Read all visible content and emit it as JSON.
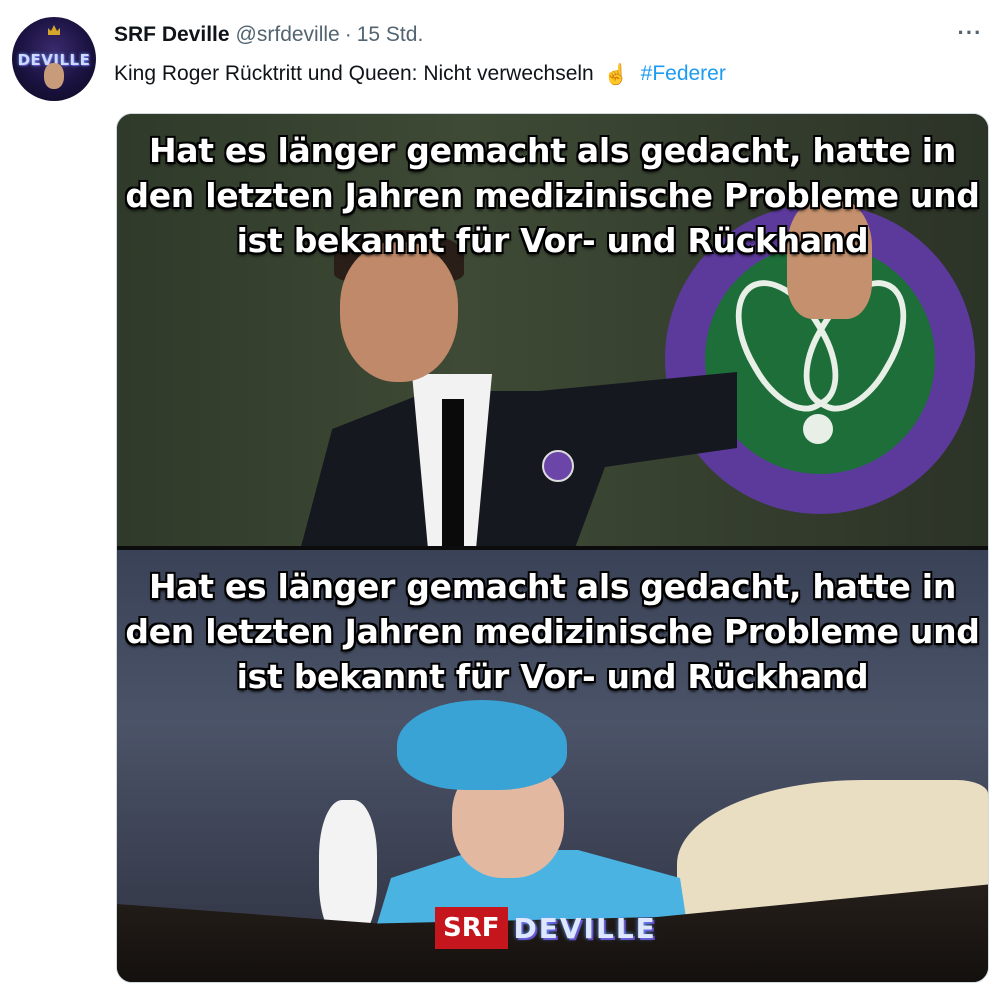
{
  "author": {
    "name": "SRF Deville",
    "handle": "@srfdeville",
    "separator": "·",
    "time": "15 Std.",
    "avatar_text": "DEVILLE"
  },
  "more_menu": {
    "icon": "more-horizontal-icon",
    "glyph": "···"
  },
  "tweet": {
    "text": "King Roger Rücktritt und Queen: Nicht verwechseln",
    "emoji": "☝",
    "hashtag": "#Federer",
    "hashtag_color": "#1d9bf0"
  },
  "media": {
    "top_caption": "Hat es länger gemacht als gedacht, hatte in den letzten Jahren medizinische Probleme und ist bekannt für Vor- und Rückhand",
    "bottom_caption": "Hat es länger gemacht als gedacht, hatte in den letzten Jahren medizinische Probleme und ist bekannt für Vor- und Rückhand",
    "watermark_srf": "SRF",
    "watermark_deville": "DEVILLE",
    "watermark_color": "#c4161c"
  }
}
